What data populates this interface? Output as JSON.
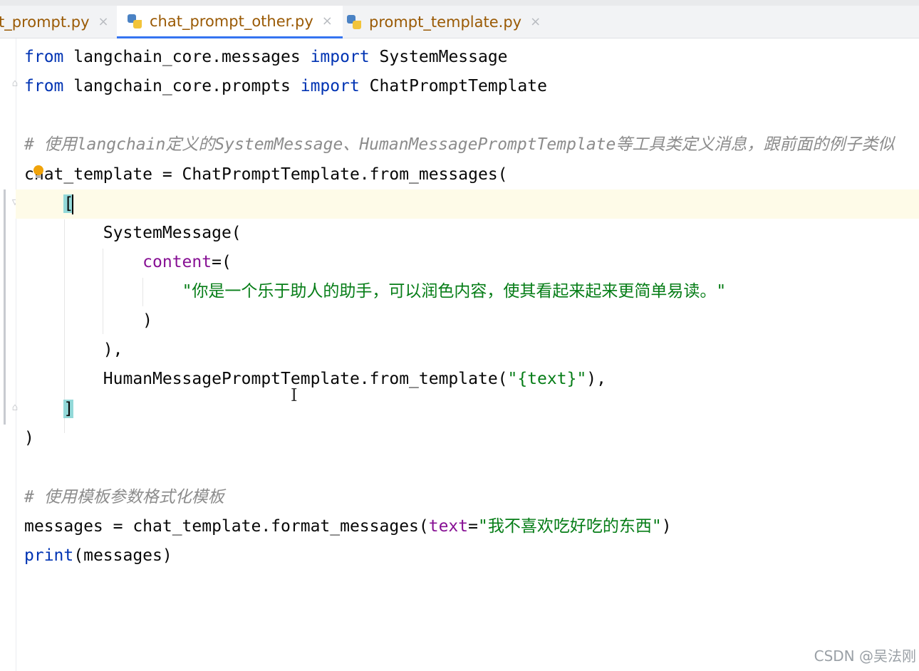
{
  "tabs": [
    {
      "label": "t_prompt.py",
      "active": false
    },
    {
      "label": "chat_prompt_other.py",
      "active": true
    },
    {
      "label": "prompt_template.py",
      "active": false
    }
  ],
  "tab_close_glyph": "×",
  "code": {
    "l1": {
      "kw1": "from",
      "mod": " langchain_core.messages ",
      "kw2": "import",
      "name": " SystemMessage"
    },
    "l2": {
      "kw1": "from",
      "mod": " langchain_core.prompts ",
      "kw2": "import",
      "name": " ChatPromptTemplate"
    },
    "l4": {
      "comment": "# 使用langchain定义的SystemMessage、HumanMessagePromptTemplate等工具类定义消息，跟前面的例子类似"
    },
    "l5": {
      "text": "chat_template = ChatPromptTemplate.from_messages("
    },
    "l6": {
      "open": "["
    },
    "l7": {
      "text": "SystemMessage("
    },
    "l8": {
      "param": "content",
      "rest": "=("
    },
    "l9": {
      "string": "\"你是一个乐于助人的助手，可以润色内容，使其看起来起来更简单易读。\""
    },
    "l10": {
      "text": ")"
    },
    "l11": {
      "text": "),"
    },
    "l12": {
      "pre": "HumanMessagePromptTemplate.from_template(",
      "string": "\"{text}\"",
      "post": "),"
    },
    "l13": {
      "close": "]"
    },
    "l14": {
      "text": ")"
    },
    "l16": {
      "comment": "# 使用模板参数格式化模板"
    },
    "l17": {
      "pre": "messages = chat_template.format_messages(",
      "param": "text",
      "eq": "=",
      "string": "\"我不喜欢吃好吃的东西\"",
      "post": ")"
    },
    "l18": {
      "kw": "print",
      "rest": "(messages)"
    }
  },
  "watermark": "CSDN @吴法刚",
  "icons": [
    "python-file-icon",
    "close-icon",
    "fold-icon",
    "lightbulb-icon",
    "text-cursor-icon"
  ],
  "colors": {
    "keyword": "#0033b3",
    "string": "#067d17",
    "param": "#871094",
    "comment": "#8c8c8c",
    "tab_text": "#9a5a05",
    "active_tab_underline": "#3574f0",
    "bracket_highlight": "#93d9d9"
  }
}
